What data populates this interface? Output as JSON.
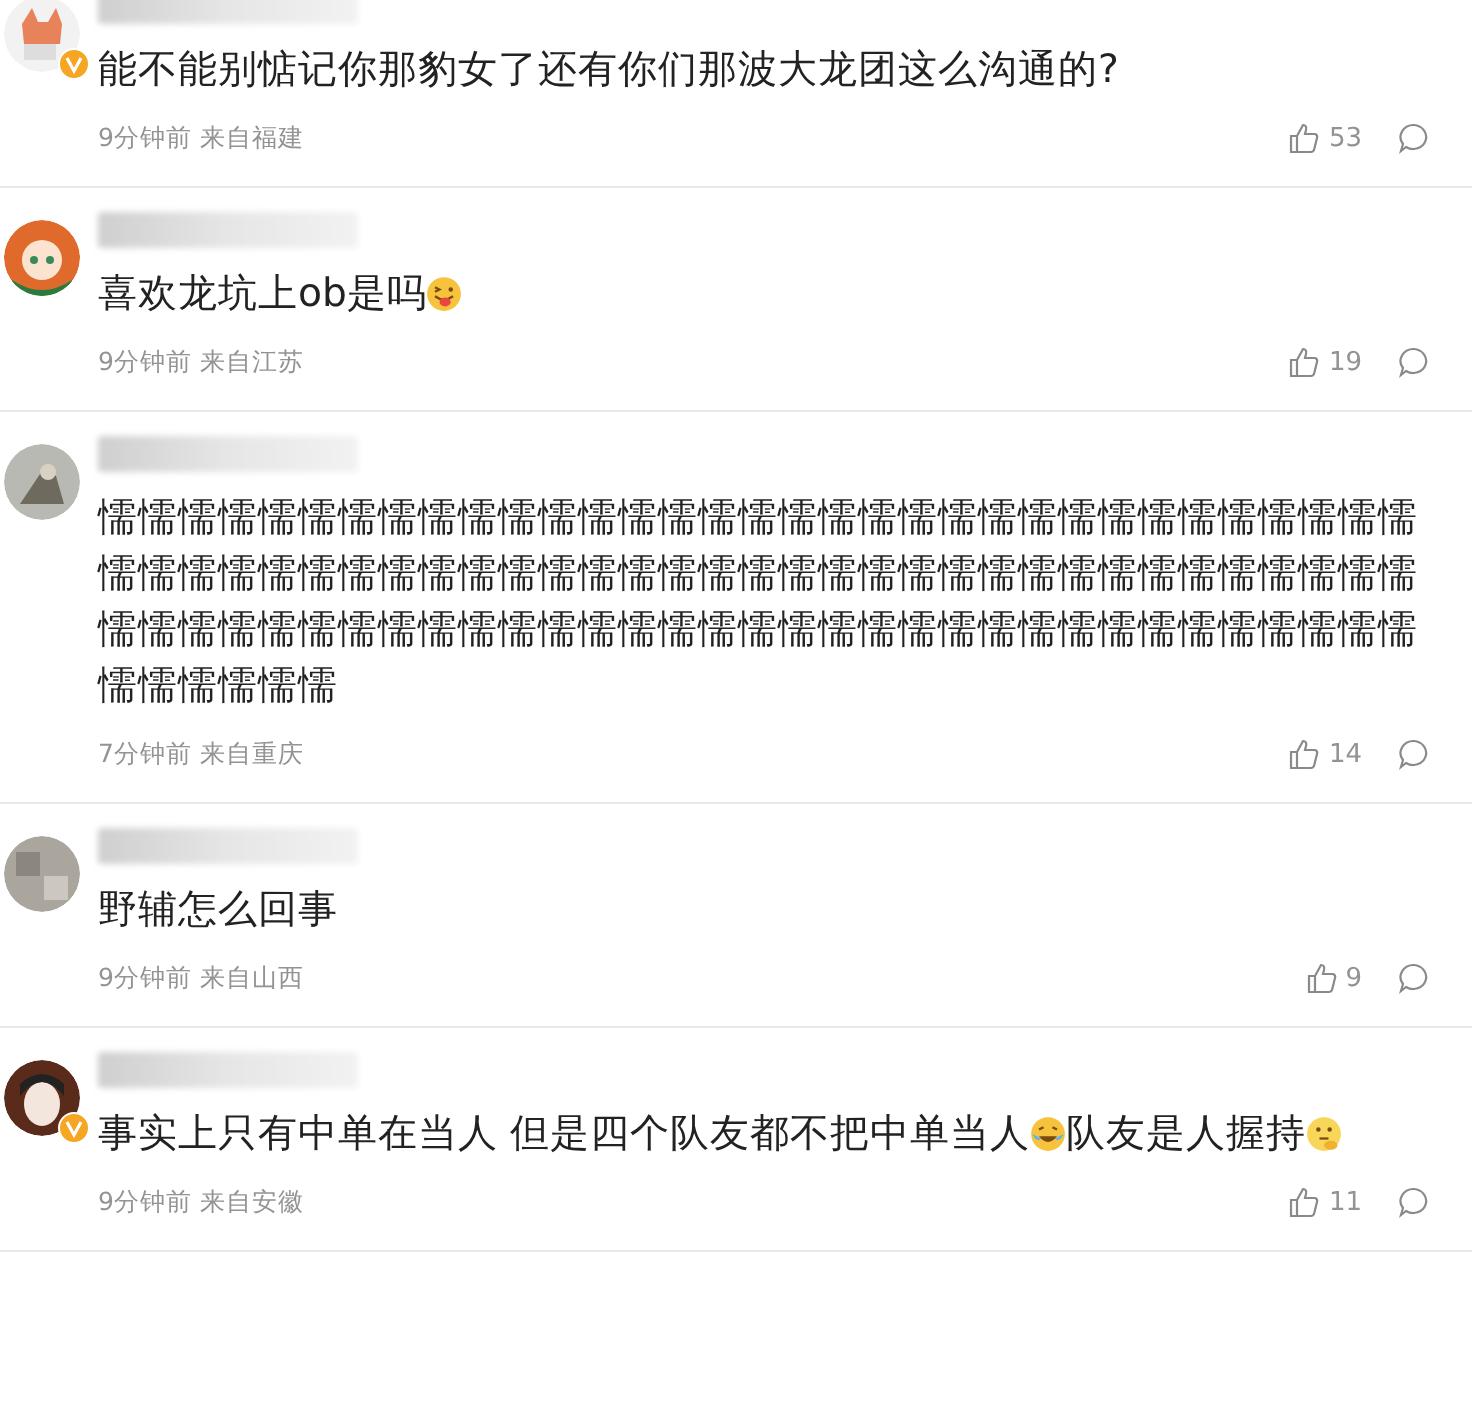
{
  "comments": [
    {
      "avatar": {
        "kind": "fox"
      },
      "verified": true,
      "parts": [
        {
          "kind": "text",
          "text": "能不能别惦记你那豹女了还有你们那波大龙团这么沟通的?"
        }
      ],
      "time": "9分钟前",
      "location": "来自福建",
      "likes": "53"
    },
    {
      "avatar": {
        "kind": "girl"
      },
      "verified": false,
      "parts": [
        {
          "kind": "text",
          "text": "喜欢龙坑上ob是吗"
        },
        {
          "kind": "tongue"
        }
      ],
      "time": "9分钟前",
      "location": "来自江苏",
      "likes": "19"
    },
    {
      "avatar": {
        "kind": "bird"
      },
      "verified": false,
      "parts": [
        {
          "kind": "text",
          "text": "懦懦懦懦懦懦懦懦懦懦懦懦懦懦懦懦懦懦懦懦懦懦懦懦懦懦懦懦懦懦懦懦懦懦懦懦懦懦懦懦懦懦懦懦懦懦懦懦懦懦懦懦懦懦懦懦懦懦懦懦懦懦懦懦懦懦懦懦懦懦懦懦懦懦懦懦懦懦懦懦懦懦懦懦懦懦懦懦懦懦懦懦懦懦懦懦懦懦懦懦懦懦懦懦懦"
        }
      ],
      "time": "7分钟前",
      "location": "来自重庆",
      "likes": "14"
    },
    {
      "avatar": {
        "kind": "gray"
      },
      "verified": false,
      "parts": [
        {
          "kind": "text",
          "text": "野辅怎么回事"
        }
      ],
      "time": "9分钟前",
      "location": "来自山西",
      "likes": "9"
    },
    {
      "avatar": {
        "kind": "person"
      },
      "verified": true,
      "parts": [
        {
          "kind": "text",
          "text": "事实上只有中单在当人 但是四个队友都不把中单当人"
        },
        {
          "kind": "crying"
        },
        {
          "kind": "text",
          "text": "队友是人握持"
        },
        {
          "kind": "thinking"
        }
      ],
      "time": "9分钟前",
      "location": "来自安徽",
      "likes": "11"
    }
  ]
}
